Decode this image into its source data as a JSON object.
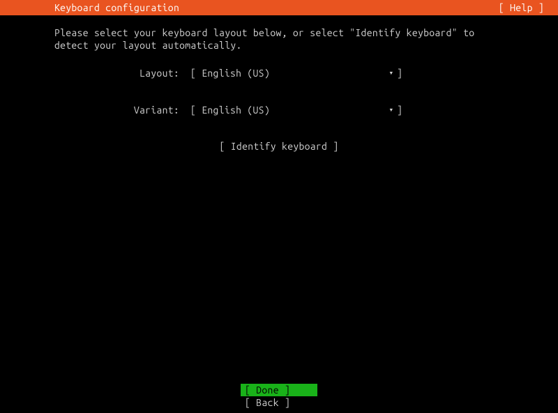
{
  "header": {
    "title": "Keyboard configuration",
    "help_label": "[ Help ]"
  },
  "instruction": "Please select your keyboard layout below, or select \"Identify keyboard\" to\ndetect your layout automatically.",
  "form": {
    "layout": {
      "label": "Layout:",
      "value": "[ English (US)",
      "caret": "▾",
      "close": "]"
    },
    "variant": {
      "label": "Variant:",
      "value": "[ English (US)",
      "caret": "▾",
      "close": "]"
    }
  },
  "identify_button": "[ Identify keyboard ]",
  "footer": {
    "done": "[ Done       ]",
    "back": "[ Back       ]"
  }
}
